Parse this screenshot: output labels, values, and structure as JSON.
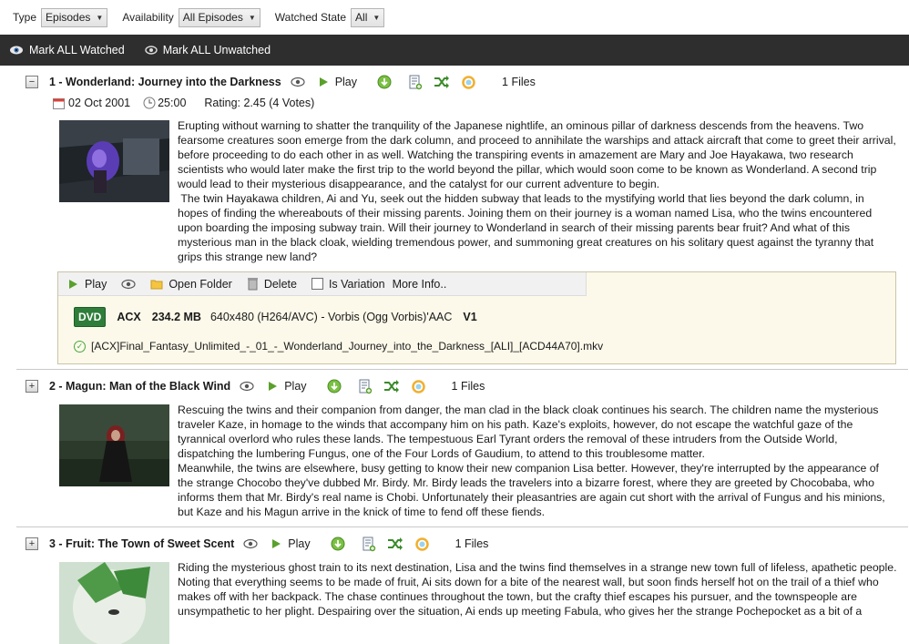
{
  "filters": {
    "type_label": "Type",
    "type_value": "Episodes",
    "availability_label": "Availability",
    "availability_value": "All Episodes",
    "watched_label": "Watched State",
    "watched_value": "All"
  },
  "actions": {
    "mark_all_watched": "Mark ALL Watched",
    "mark_all_unwatched": "Mark ALL Unwatched"
  },
  "episodes": [
    {
      "title": "1 - Wonderland: Journey into the Darkness",
      "play": "Play",
      "files": "1 Files",
      "expanded": true,
      "date": "02 Oct 2001",
      "duration": "25:00",
      "rating": "Rating: 2.45 (4 Votes)",
      "description": "Erupting without warning to shatter the tranquility of the Japanese nightlife, an ominous pillar of darkness descends from the heavens. Two fearsome creatures soon emerge from the dark column, and proceed to annihilate the warships and attack aircraft that come to greet their arrival, before proceeding to do each other in as well. Watching the transpiring events in amazement are Mary and Joe Hayakawa, two research scientists who would later make the first trip to the world beyond the pillar, which would soon come to be known as Wonderland. A second trip would lead to their mysterious disappearance, and the catalyst for our current adventure to begin.\n The twin Hayakawa children, Ai and Yu, seek out the hidden subway that leads to the mystifying world that lies beyond the dark column, in hopes of finding the whereabouts of their missing parents. Joining them on their journey is a woman named Lisa, who the twins encountered upon boarding the imposing subway train. Will their journey to Wonderland in search of their missing parents bear fruit? And what of this mysterious man in the black cloak, wielding tremendous power, and summoning great creatures on his solitary quest against the tyranny that grips this strange new land?",
      "file_panel": {
        "play": "Play",
        "open_folder": "Open Folder",
        "delete": "Delete",
        "is_variation": "Is Variation",
        "more_info": "More Info..",
        "source_badge": "DVD",
        "group": "ACX",
        "size": "234.2 MB",
        "video": "640x480 (H264/AVC) - Vorbis (Ogg Vorbis)'AAC",
        "version": "V1",
        "filename": "[ACX]Final_Fantasy_Unlimited_-_01_-_Wonderland_Journey_into_the_Darkness_[ALI]_[ACD44A70].mkv"
      }
    },
    {
      "title": "2 - Magun: Man of the Black Wind",
      "play": "Play",
      "files": "1 Files",
      "expanded": false,
      "description": "Rescuing the twins and their companion from danger, the man clad in the black cloak continues his search. The children name the mysterious traveler Kaze, in homage to the winds that accompany him on his path. Kaze's exploits, however, do not escape the watchful gaze of the tyrannical overlord who rules these lands. The tempestuous Earl Tyrant orders the removal of these intruders from the Outside World, dispatching the lumbering Fungus, one of the Four Lords of Gaudium, to attend to this troublesome matter.\nMeanwhile, the twins are elsewhere, busy getting to know their new companion Lisa better. However, they're interrupted by the appearance of the strange Chocobo they've dubbed Mr. Birdy. Mr. Birdy leads the travelers into a bizarre forest, where they are greeted by Chocobaba, who informs them that Mr. Birdy's real name is Chobi. Unfortunately their pleasantries are again cut short with the arrival of Fungus and his minions, but Kaze and his Magun arrive in the knick of time to fend off these fiends."
    },
    {
      "title": "3 - Fruit: The Town of Sweet Scent",
      "play": "Play",
      "files": "1 Files",
      "expanded": false,
      "description": "Riding the mysterious ghost train to its next destination, Lisa and the twins find themselves in a strange new town full of lifeless, apathetic people. Noting that everything seems to be made of fruit, Ai sits down for a bite of the nearest wall, but soon finds herself hot on the trail of a thief who makes off with her backpack. The chase continues throughout the town, but the crafty thief escapes his pursuer, and the townspeople are unsympathetic to her plight. Despairing over the situation, Ai ends up meeting Fabula, who gives her the strange Pochepocket as a bit of a"
    }
  ],
  "colors": {
    "action_bar_bg": "#2e2e2e",
    "play_green": "#5aa02c",
    "dvd_badge": "#2f7d3a",
    "file_panel_bg": "#fcf9ea"
  }
}
